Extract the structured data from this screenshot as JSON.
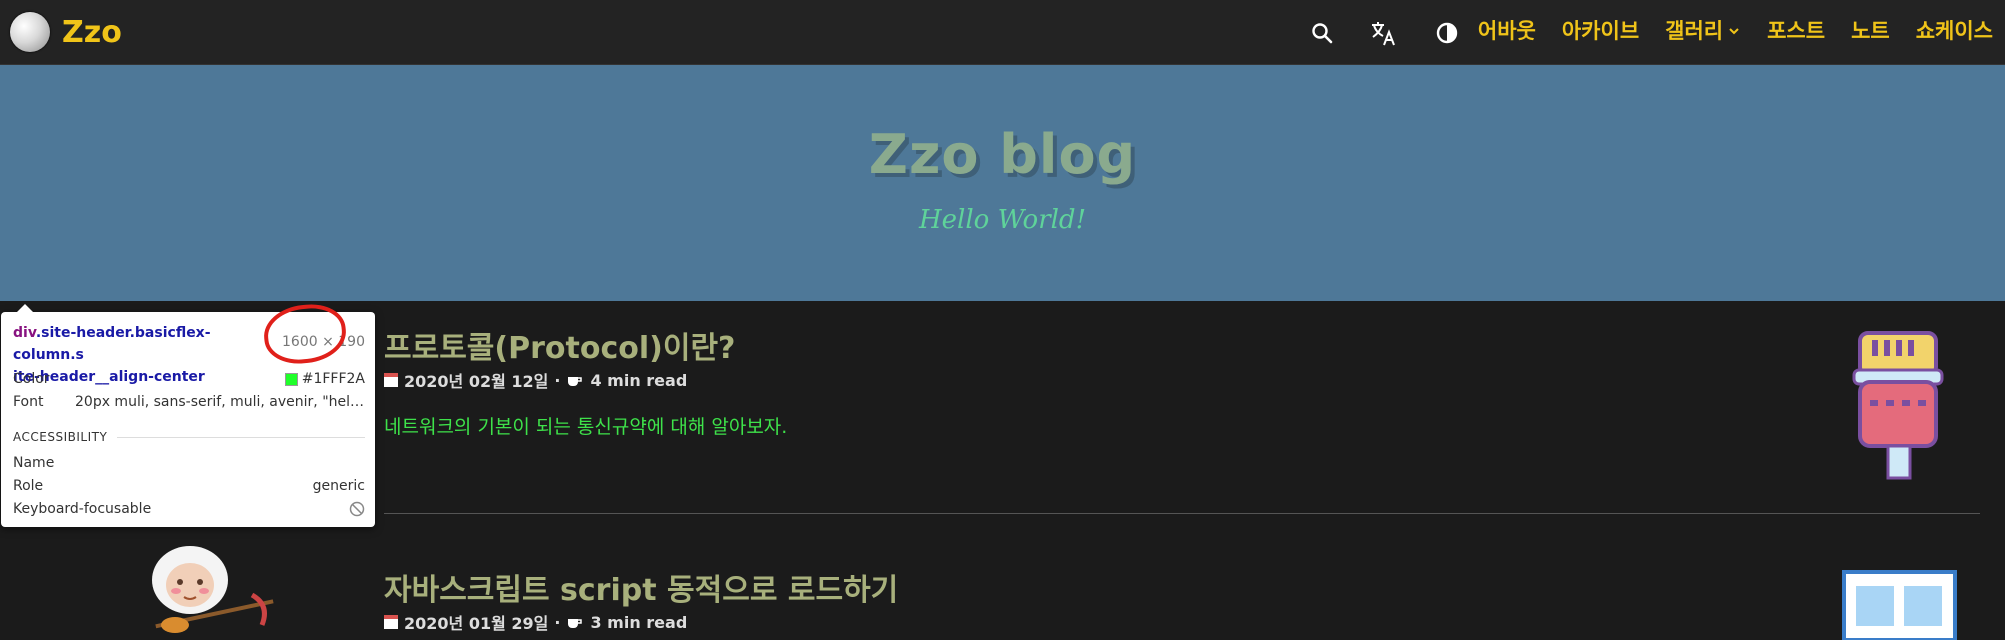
{
  "navbar": {
    "logo_text": "Zzo",
    "links": [
      "어바웃",
      "아카이브",
      "갤러리",
      "포스트",
      "노트",
      "쇼케이스"
    ]
  },
  "hero": {
    "title": "Zzo blog",
    "subtitle": "Hello World!"
  },
  "posts": [
    {
      "title": "프로토콜(Protocol)이란?",
      "date": "2020년 02월 12일",
      "read_time": "4 min read",
      "summary": "네트워크의 기본이 되는 통신규약에 대해 알아보자."
    },
    {
      "title": "자바스크립트 script 동적으로 로드하기",
      "date": "2020년 01월 29일",
      "read_time": "3 min read"
    }
  ],
  "meta_separator": "·",
  "tooltip": {
    "selector_tag": "div",
    "selector_class_line1": ".site-header.basicflex-column.s",
    "selector_class_line2": "ite-header__align-center",
    "dimensions": "1600 × 190",
    "color_label": "Color",
    "color_value": "#1FFF2A",
    "font_label": "Font",
    "font_value": "20px muli, sans-serif, muli, avenir, \"helvet...",
    "section_title": "ACCESSIBILITY",
    "name_label": "Name",
    "role_label": "Role",
    "role_value": "generic",
    "focusable_label": "Keyboard-focusable"
  },
  "colors": {
    "nav_link": "#f0c419",
    "hero_bg": "#4e7898",
    "post_title": "#a8b07c",
    "summary": "#3ee24a"
  }
}
